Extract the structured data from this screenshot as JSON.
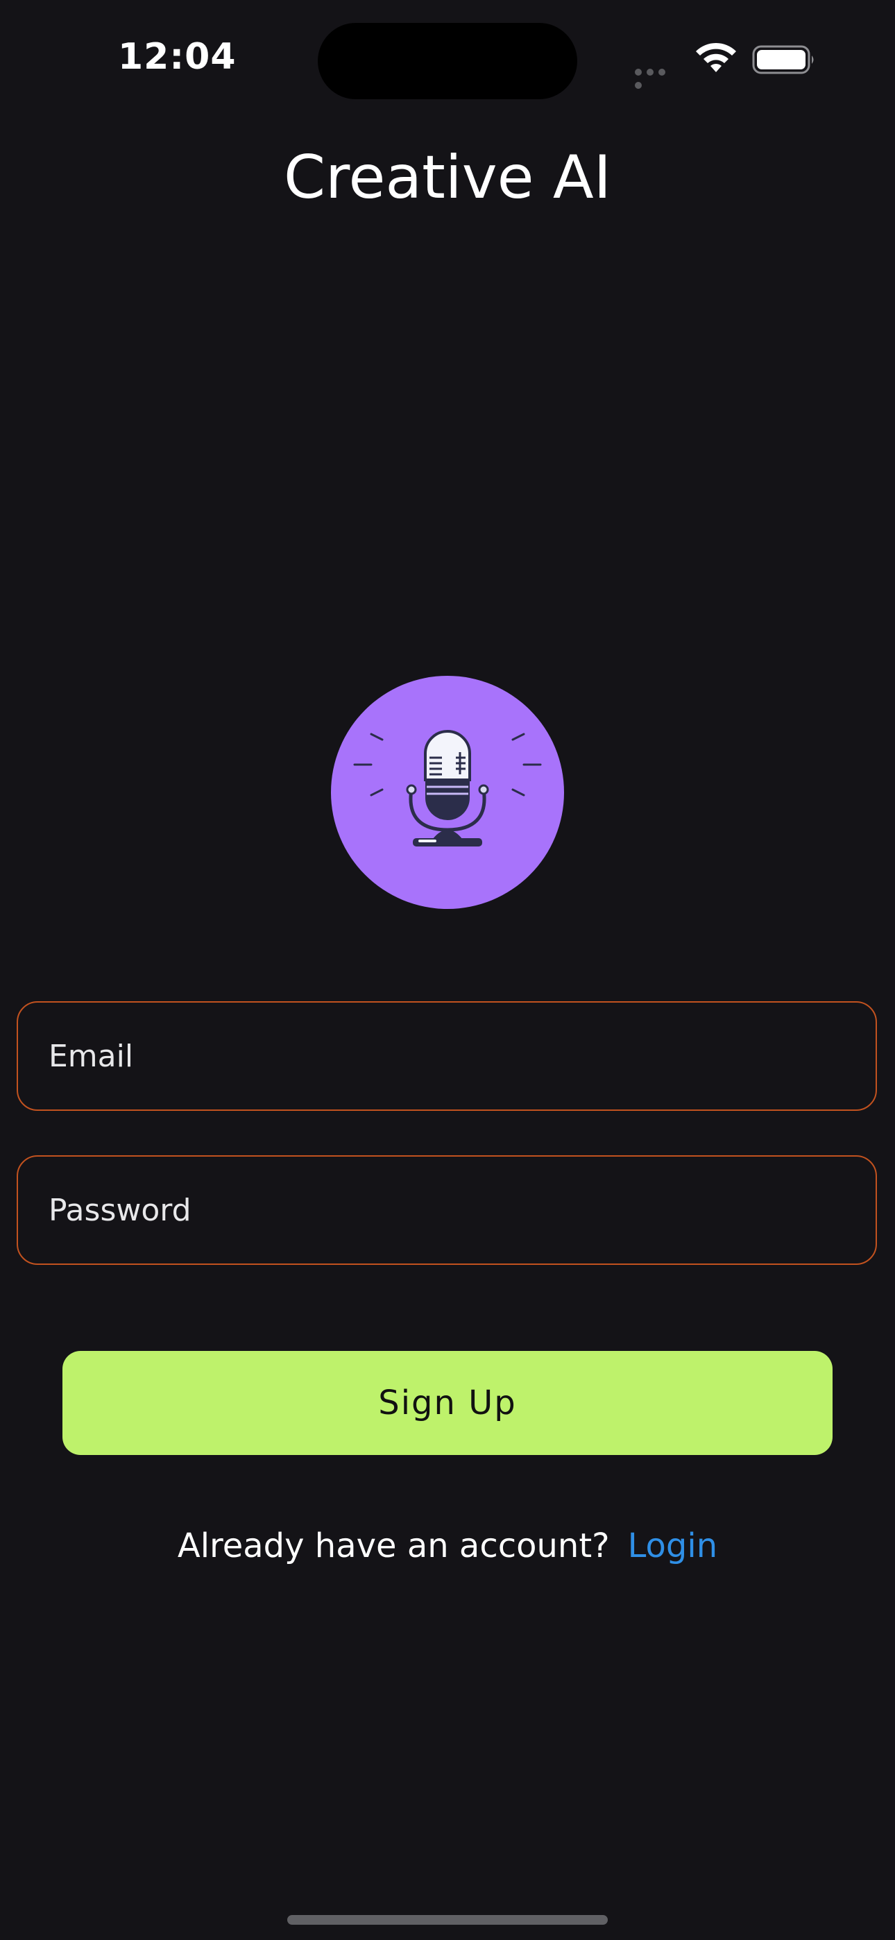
{
  "status_bar": {
    "time": "12:04"
  },
  "header": {
    "title": "Creative AI"
  },
  "logo": {
    "icon": "microphone-icon",
    "background_color": "#A873FB"
  },
  "form": {
    "email_placeholder": "Email",
    "password_placeholder": "Password",
    "signup_label": "Sign Up",
    "input_border_color": "#C2521F",
    "button_color": "#BEF26B"
  },
  "footer": {
    "prompt_text": "Already have an account?",
    "login_label": "Login",
    "link_color": "#2F8FE6"
  }
}
